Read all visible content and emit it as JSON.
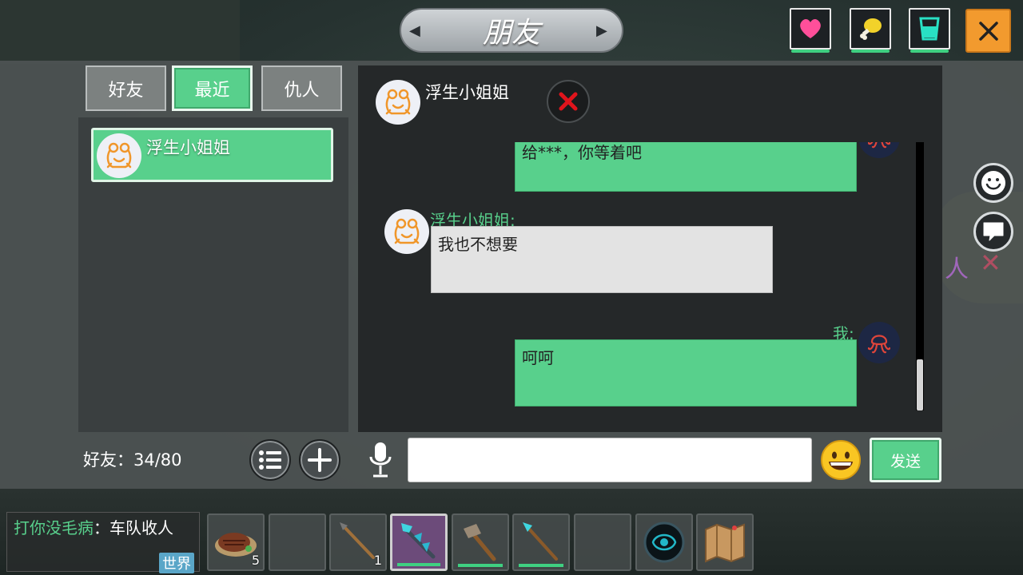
{
  "title": "朋友",
  "tabs": [
    {
      "label": "好友",
      "active": false
    },
    {
      "label": "最近",
      "active": true
    },
    {
      "label": "仇人",
      "active": false
    }
  ],
  "friend_list": [
    {
      "name": "浮生小姐姐",
      "avatar": "frog-icon",
      "selected": true
    }
  ],
  "chat": {
    "contact_name": "浮生小姐姐",
    "messages": [
      {
        "from": "me",
        "text": "给***，你等着吧"
      },
      {
        "from": "them",
        "sender": "浮生小姐姐:",
        "text": "我也不想要"
      },
      {
        "from": "me",
        "sender": "我:",
        "text": "呵呵"
      }
    ]
  },
  "footer": {
    "friend_count": "好友：34/80",
    "input_value": "",
    "send_label": "发送"
  },
  "chat_log": {
    "sender": "打你没毛病",
    "separator": "：",
    "text": "车队收人",
    "channel": "世界"
  },
  "hotbar": [
    {
      "item": "steak-icon",
      "count": "5"
    },
    {
      "item": "empty",
      "count": ""
    },
    {
      "item": "spear-icon",
      "count": "1"
    },
    {
      "item": "crystal-staff-icon",
      "count": ""
    },
    {
      "item": "stone-axe-icon",
      "count": ""
    },
    {
      "item": "crystal-spear-icon",
      "count": ""
    },
    {
      "item": "empty",
      "count": ""
    },
    {
      "item": "portal-orb-icon",
      "count": ""
    },
    {
      "item": "treasure-map-icon",
      "count": ""
    }
  ],
  "colors": {
    "accent_green": "#58d08c",
    "close_orange": "#f29a2e",
    "panel_dark": "#252829"
  }
}
